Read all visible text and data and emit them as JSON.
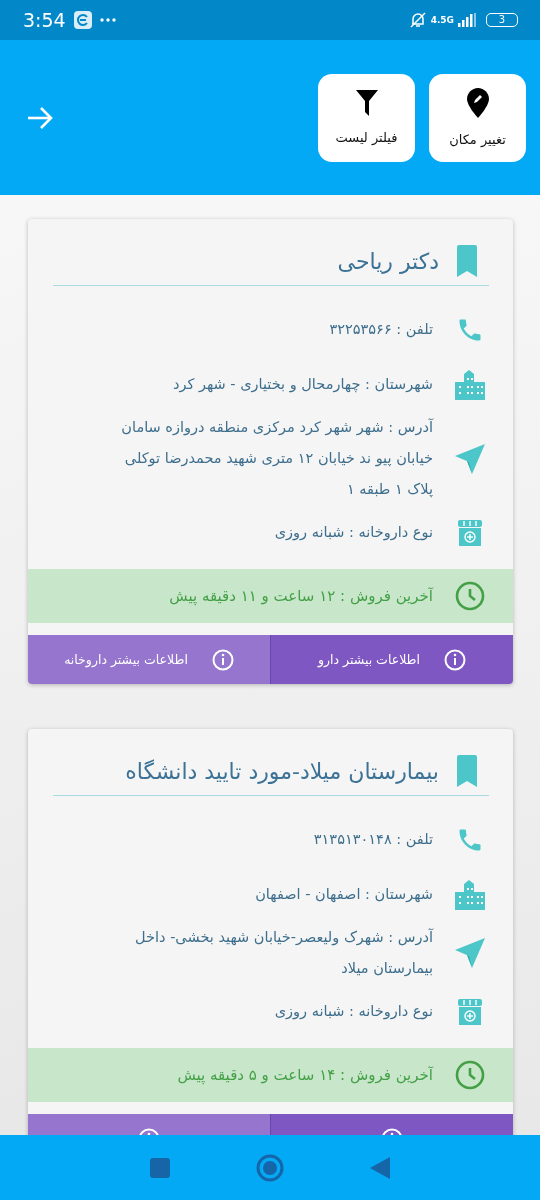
{
  "status_bar": {
    "time": "3:54",
    "network": "4.5G",
    "battery": "3"
  },
  "header": {
    "buttons": [
      {
        "kind": "location",
        "label": "تغییر مکان"
      },
      {
        "kind": "filter",
        "label": "فیلتر لیست"
      }
    ]
  },
  "cards": [
    {
      "title": "دکتر ریاحی",
      "rows": [
        {
          "kind": "phone",
          "text": "تلفن : ۳۲۲۵۳۵۶۶"
        },
        {
          "kind": "city",
          "text": "شهرستان : چهارمحال و بختیاری - شهر کرد"
        },
        {
          "kind": "address",
          "text": "آدرس : شهر شهر کرد مرکزی منطقه دروازه سامان خیابان پیو ند خیابان ۱۲ متری شهید محمدرضا توکلی پلاک ۱ طبقه ۱"
        },
        {
          "kind": "type",
          "text": "نوع داروخانه : شبانه روزی"
        }
      ],
      "last_sale": "آخرین فروش : ۱۲ ساعت و ۱۱ دقیقه پیش",
      "actions": [
        {
          "kind": "info",
          "label": "اطلاعات بیشتر دارو"
        },
        {
          "kind": "info",
          "label": "اطلاعات بیشتر داروخانه"
        }
      ]
    },
    {
      "title": "بیمارستان میلاد-مورد تایید دانشگاه",
      "rows": [
        {
          "kind": "phone",
          "text": "تلفن : ۳۱۳۵۱۳۰۱۴۸"
        },
        {
          "kind": "city",
          "text": "شهرستان : اصفهان - اصفهان"
        },
        {
          "kind": "address",
          "text": "آدرس : شهرک ولیعصر-خیابان شهید بخشی- داخل بیمارستان میلاد"
        },
        {
          "kind": "type",
          "text": "نوع داروخانه : شبانه روزی"
        }
      ],
      "last_sale": "آخرین فروش : ۱۴ ساعت و ۵ دقیقه پیش",
      "actions": [
        {
          "kind": "info"
        },
        {
          "kind": "info"
        }
      ]
    }
  ]
}
